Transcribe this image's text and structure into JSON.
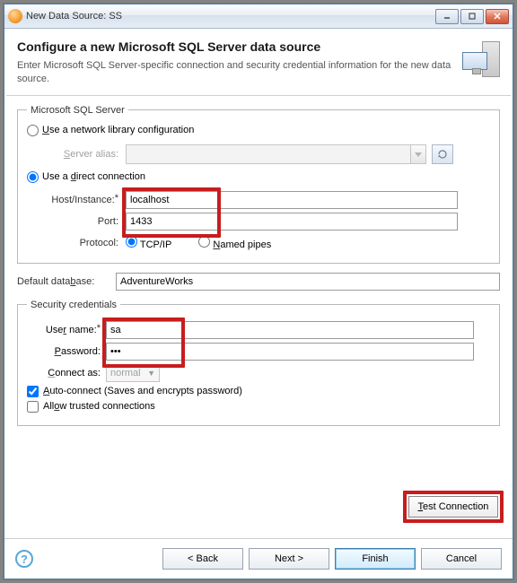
{
  "window": {
    "title": "New Data Source: SS"
  },
  "header": {
    "title": "Configure a new Microsoft SQL Server data source",
    "subtitle": "Enter Microsoft SQL Server-specific connection and security credential information for the new data source."
  },
  "sql": {
    "legend": "Microsoft SQL Server",
    "use_network_lib": "Use a network library configuration",
    "server_alias_label": "Server alias:",
    "server_alias_value": "",
    "use_direct": "Use a direct connection",
    "host_label": "Host/Instance:",
    "host_value": "localhost",
    "port_label": "Port:",
    "port_value": "1433",
    "protocol_label": "Protocol:",
    "tcpip": "TCP/IP",
    "named_pipes": "Named pipes"
  },
  "db": {
    "label": "Default database:",
    "value": "AdventureWorks"
  },
  "security": {
    "legend": "Security credentials",
    "user_label": "User name:",
    "user_value": "sa",
    "password_label": "Password:",
    "password_value": "•••",
    "connect_as_label": "Connect as:",
    "connect_as_value": "normal",
    "auto_connect": "Auto-connect (Saves and encrypts password)",
    "auto_connect_checked": true,
    "allow_trusted": "Allow trusted connections",
    "allow_trusted_checked": false
  },
  "buttons": {
    "test": "Test Connection",
    "back": "< Back",
    "next": "Next >",
    "finish": "Finish",
    "cancel": "Cancel"
  },
  "colors": {
    "highlight": "#c71d1d",
    "primary": "#3c7fb1"
  }
}
